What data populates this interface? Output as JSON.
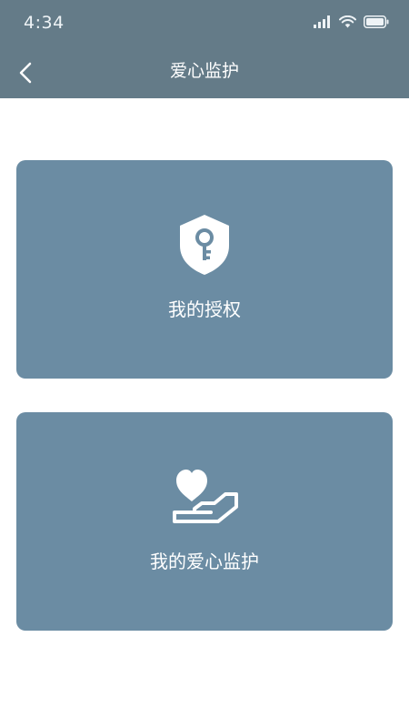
{
  "status_bar": {
    "time": "4:34"
  },
  "nav": {
    "title": "爱心监护",
    "back_icon": "chevron-left-icon"
  },
  "cards": [
    {
      "label": "我的授权",
      "icon": "shield-key-icon"
    },
    {
      "label": "我的爱心监护",
      "icon": "heart-hand-icon"
    }
  ],
  "colors": {
    "header_bg": "#647b88",
    "card_bg": "#6b8ca3",
    "text_on_color": "#ffffff",
    "page_bg": "#ffffff"
  }
}
